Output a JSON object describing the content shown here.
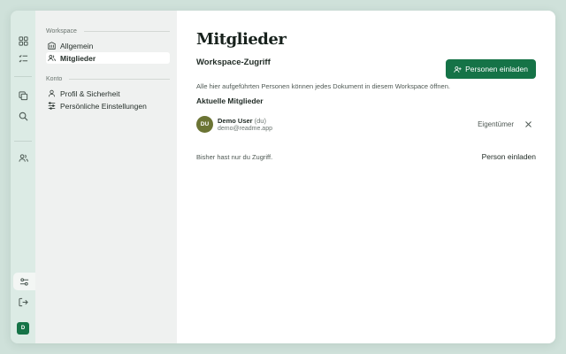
{
  "sidebar": {
    "workspace_label": "Workspace",
    "account_label": "Konto",
    "workspace_items": [
      {
        "label": "Allgemein",
        "icon": "building-icon",
        "active": false
      },
      {
        "label": "Mitglieder",
        "icon": "users-icon",
        "active": true
      }
    ],
    "account_items": [
      {
        "label": "Profil & Sicherheit",
        "icon": "user-icon",
        "active": false
      },
      {
        "label": "Persönliche Einstellungen",
        "icon": "sliders-icon",
        "active": false
      }
    ]
  },
  "rail": {
    "user_initial": "D"
  },
  "main": {
    "title": "Mitglieder",
    "section_title": "Workspace-Zugriff",
    "invite_button": "Personen einladen",
    "description": "Alle hier aufgeführten Personen können jedes Dokument in diesem Workspace öffnen.",
    "members_title": "Aktuelle Mitglieder",
    "members": [
      {
        "initials": "DU",
        "name": "Demo User",
        "suffix": "(du)",
        "email": "demo@readme.app",
        "role": "Eigentümer"
      }
    ],
    "footer_note": "Bisher hast nur du Zugriff.",
    "footer_link": "Person einladen"
  },
  "colors": {
    "accent": "#157347",
    "avatar": "#6b7434",
    "background": "#cfe1da"
  }
}
